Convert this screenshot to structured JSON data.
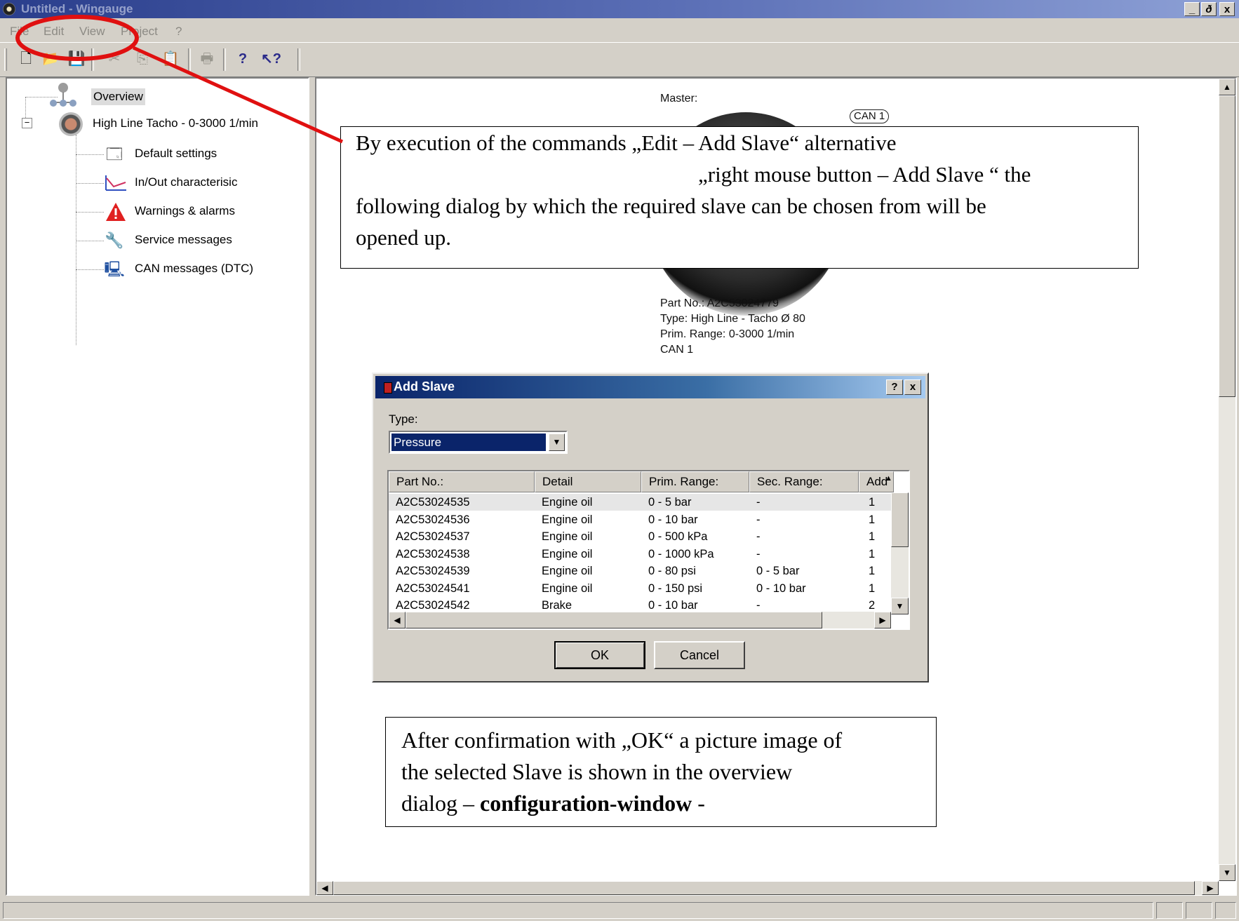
{
  "window": {
    "title": "Untitled - Wingauge",
    "controls": [
      "_",
      "ð",
      "x"
    ]
  },
  "menu": [
    "File",
    "Edit",
    "View",
    "Project",
    "?"
  ],
  "tree": {
    "root": "Overview",
    "device": "High Line Tacho - 0-3000 1/min",
    "children": [
      "Default settings",
      "In/Out characterisic",
      "Warnings & alarms",
      "Service messages",
      "CAN messages (DTC)"
    ]
  },
  "master": {
    "heading": "Master:",
    "can_badge": "CAN 1",
    "info": [
      "Part No.: A2C53024779",
      "Type: High Line - Tacho Ø 80",
      "Prim. Range: 0-3000 1/min",
      "CAN 1"
    ]
  },
  "callout_top": {
    "line1": "By execution of the commands   „Edit – Add Slave“  alternative",
    "line2": "„right mouse button – Add Slave “ the",
    "line3": "following dialog by which the required slave can be chosen from will be",
    "line4": "opened up."
  },
  "callout_bottom": {
    "line1": "After confirmation with „OK“ a picture image of",
    "line2": "the selected Slave is shown in the overview",
    "line3_a": "dialog  – ",
    "line3_b": "configuration-window",
    "line3_c": " -"
  },
  "dialog": {
    "title": "Add Slave",
    "help": "?",
    "close": "x",
    "type_label": "Type:",
    "type_value": "Pressure",
    "columns": [
      "Part No.:",
      "Detail",
      "Prim. Range:",
      "Sec. Range:",
      "Add"
    ],
    "rows": [
      [
        "A2C53024535",
        "Engine oil",
        "0 - 5 bar",
        "-",
        "1"
      ],
      [
        "A2C53024536",
        "Engine oil",
        "0 - 10 bar",
        "-",
        "1"
      ],
      [
        "A2C53024537",
        "Engine oil",
        "0 - 500 kPa",
        "-",
        "1"
      ],
      [
        "A2C53024538",
        "Engine oil",
        "0 - 1000 kPa",
        "-",
        "1"
      ],
      [
        "A2C53024539",
        "Engine oil",
        "0 - 80 psi",
        "0 - 5 bar",
        "1"
      ],
      [
        "A2C53024541",
        "Engine oil",
        "0 - 150 psi",
        "0 - 10 bar",
        "1"
      ],
      [
        "A2C53024542",
        "Brake",
        "0 - 10 bar",
        "-",
        "2"
      ]
    ],
    "ok": "OK",
    "cancel": "Cancel"
  },
  "colors": {
    "annotation": "#e01010",
    "dialog_title": "#0a246a"
  }
}
